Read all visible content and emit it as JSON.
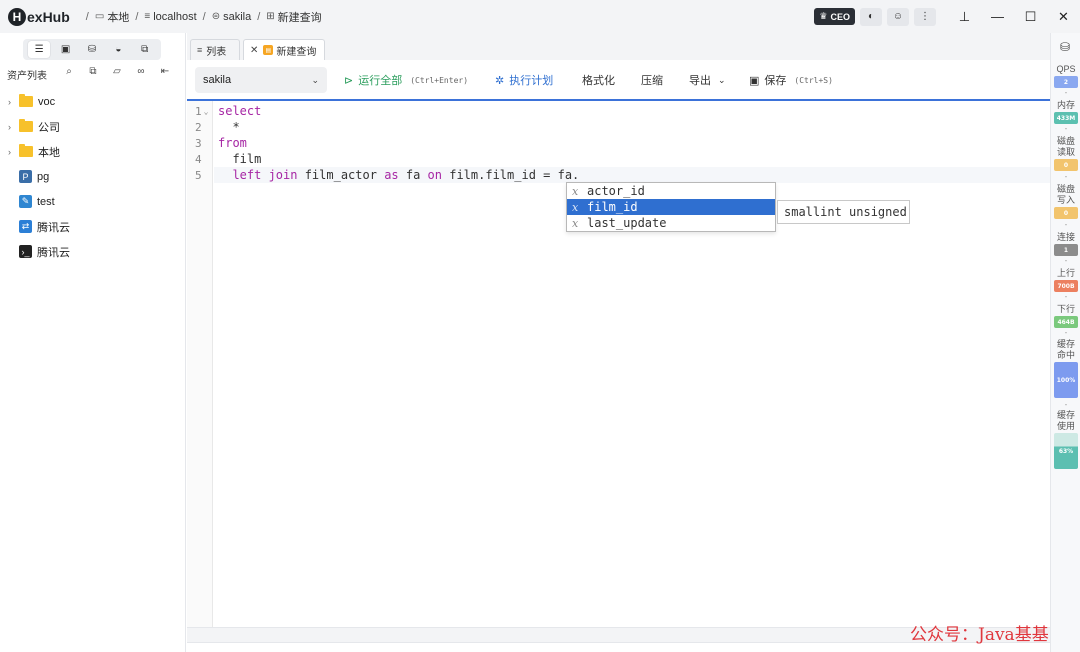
{
  "app": {
    "name": "HexHub",
    "logo_letter": "H",
    "logo_rest": "exHub"
  },
  "breadcrumb": [
    {
      "icon": "folder-outline-icon",
      "label": "本地"
    },
    {
      "icon": "server-icon",
      "label": "localhost"
    },
    {
      "icon": "database-icon",
      "label": "sakila"
    },
    {
      "icon": "query-icon",
      "label": "新建查询"
    }
  ],
  "titlebar": {
    "ceo_label": "CEO",
    "theme_icon": "contrast-icon",
    "user_icon": "user-icon",
    "more_icon": "more-vertical-icon",
    "pin_icon": "pin-icon"
  },
  "sidebar": {
    "title": "资产列表",
    "tabs": [
      "assets-list-icon",
      "terminal-icon",
      "database-stack-icon",
      "docker-icon",
      "remote-desktop-icon"
    ],
    "tree": [
      {
        "label": "voc",
        "type": "folder",
        "expandable": true
      },
      {
        "label": "公司",
        "type": "folder",
        "expandable": true
      },
      {
        "label": "本地",
        "type": "folder",
        "expandable": true
      },
      {
        "label": "pg",
        "type": "postgres",
        "expandable": false
      },
      {
        "label": "test",
        "type": "edit",
        "expandable": false
      },
      {
        "label": "腾讯云",
        "type": "remote",
        "expandable": false
      },
      {
        "label": "腾讯云",
        "type": "terminal",
        "expandable": false
      }
    ]
  },
  "tabs": [
    {
      "label": "列表",
      "icon": "list-icon",
      "active": false
    },
    {
      "label": "新建查询",
      "icon": "sql-file-icon",
      "active": true
    }
  ],
  "toolbar": {
    "database": "sakila",
    "run_all": "运行全部",
    "run_all_hint": "(Ctrl+Enter)",
    "explain": "执行计划",
    "format": "格式化",
    "compress": "压缩",
    "export": "导出",
    "save": "保存",
    "save_hint": "(Ctrl+S)"
  },
  "editor": {
    "lines": [
      {
        "num": "1",
        "fold": true,
        "parts": [
          {
            "t": "select",
            "kw": true
          }
        ]
      },
      {
        "num": "2",
        "fold": false,
        "parts": [
          {
            "t": "  *",
            "kw": false
          }
        ]
      },
      {
        "num": "3",
        "fold": false,
        "parts": [
          {
            "t": "from",
            "kw": true
          }
        ]
      },
      {
        "num": "4",
        "fold": false,
        "parts": [
          {
            "t": "  film",
            "kw": false
          }
        ]
      },
      {
        "num": "5",
        "fold": false,
        "parts": [
          {
            "t": "  ",
            "kw": false
          },
          {
            "t": "left join",
            "kw": true
          },
          {
            "t": " film_actor ",
            "kw": false
          },
          {
            "t": "as",
            "kw": true
          },
          {
            "t": " fa ",
            "kw": false
          },
          {
            "t": "on",
            "kw": true
          },
          {
            "t": " film.film_id = fa.",
            "kw": false
          }
        ]
      }
    ]
  },
  "autocomplete": {
    "items": [
      {
        "label": "actor_id",
        "selected": false
      },
      {
        "label": "film_id",
        "selected": true
      },
      {
        "label": "last_update",
        "selected": false
      }
    ],
    "type_marker": "x",
    "detail": "smallint unsigned"
  },
  "metrics": [
    {
      "label": "QPS",
      "value": "2",
      "color": "#8aa8f0"
    },
    {
      "label": "内存",
      "value": "433M",
      "color": "#5cc0b0"
    },
    {
      "label": "磁盘读取",
      "value": "0",
      "color": "#f2c46d"
    },
    {
      "label": "磁盘写入",
      "value": "0",
      "color": "#f2c46d"
    },
    {
      "label": "连接",
      "value": "1",
      "color": "#8c8c8c"
    },
    {
      "label": "上行",
      "value": "700B",
      "color": "#ec8060"
    },
    {
      "label": "下行",
      "value": "464B",
      "color": "#7bc97d"
    },
    {
      "label": "缓存命中",
      "value": "100%",
      "color": "#7d9bef"
    },
    {
      "label": "缓存使用",
      "value": "63%",
      "color": "#5cbfb1"
    }
  ],
  "watermark": "公众号：Java基基"
}
